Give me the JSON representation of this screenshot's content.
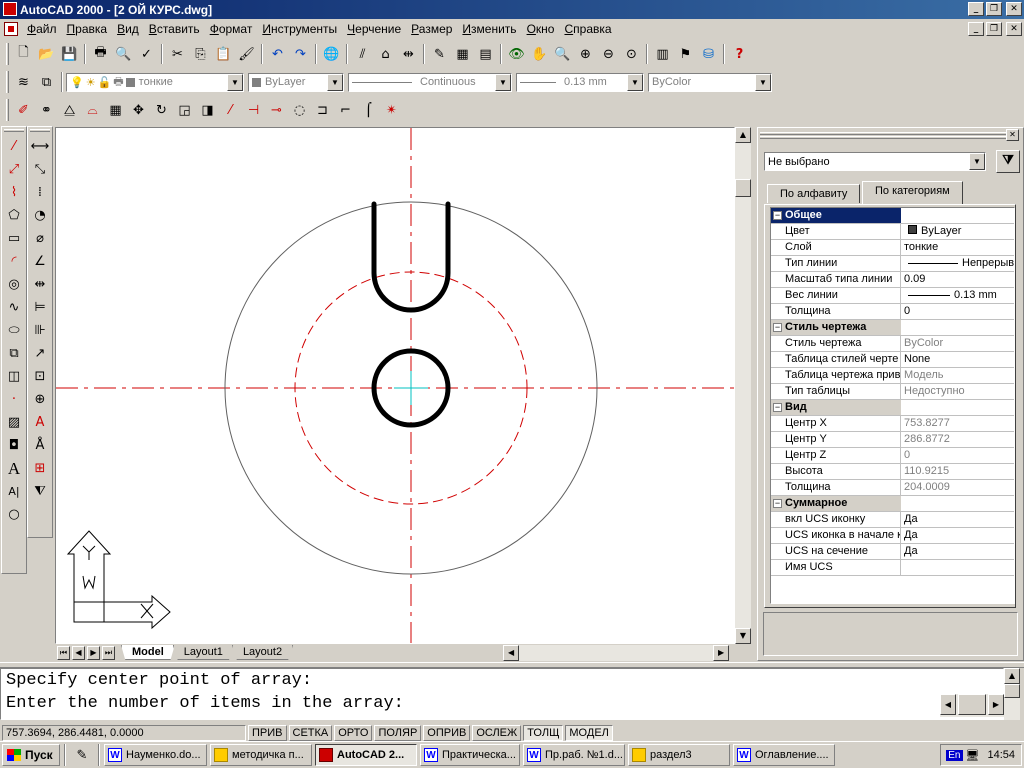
{
  "window": {
    "title": "AutoCAD 2000 - [2 ОЙ КУРС.dwg]",
    "min_glyph": "_",
    "max_glyph": "❐",
    "close_glyph": "✕"
  },
  "menu": {
    "items": [
      {
        "u": "Ф",
        "rest": "айл"
      },
      {
        "u": "П",
        "rest": "равка"
      },
      {
        "u": "В",
        "rest": "ид"
      },
      {
        "u": "В",
        "rest": "ставить"
      },
      {
        "u": "Ф",
        "rest": "ормат"
      },
      {
        "u": "И",
        "rest": "нструменты"
      },
      {
        "u": "Ч",
        "rest": "ерчение"
      },
      {
        "u": "Р",
        "rest": "азмер"
      },
      {
        "u": "И",
        "rest": "зменить"
      },
      {
        "u": "О",
        "rest": "кно"
      },
      {
        "u": "С",
        "rest": "правка"
      }
    ]
  },
  "layers_toolbar": {
    "layer": "тонкие",
    "color": "ByLayer",
    "linetype": "Continuous",
    "lineweight": "0.13 mm",
    "plotstyle": "ByColor"
  },
  "ucs_icon": {
    "x_label": "X",
    "y_label": "Y",
    "w_label": "W"
  },
  "layout_tabs": [
    "Model",
    "Layout1",
    "Layout2"
  ],
  "properties": {
    "selection": "Не выбрано",
    "tab_alpha": "По алфавиту",
    "tab_category": "По категориям",
    "groups": [
      {
        "name": "Общее",
        "rows": [
          {
            "k": "Цвет",
            "v": "ByLayer",
            "swatch": true
          },
          {
            "k": "Слой",
            "v": "тонкие"
          },
          {
            "k": "Тип линии",
            "v": "Непрерывн",
            "line": true
          },
          {
            "k": "Масштаб типа линии",
            "v": "0.09"
          },
          {
            "k": "Вес линии",
            "v": "0.13 mm",
            "line": true
          },
          {
            "k": "Толщина",
            "v": "0"
          }
        ]
      },
      {
        "name": "Стиль чертежа",
        "rows": [
          {
            "k": "Стиль чертежа",
            "v": "ByColor",
            "dim": true
          },
          {
            "k": "Таблица стилей черте",
            "v": "None"
          },
          {
            "k": "Таблица чертежа прив",
            "v": "Модель",
            "dim": true
          },
          {
            "k": "Тип таблицы",
            "v": "Недоступно",
            "dim": true
          }
        ]
      },
      {
        "name": "Вид",
        "rows": [
          {
            "k": "Центр X",
            "v": "753.8277",
            "dim": true
          },
          {
            "k": "Центр Y",
            "v": "286.8772",
            "dim": true
          },
          {
            "k": "Центр Z",
            "v": "0",
            "dim": true
          },
          {
            "k": "Высота",
            "v": "110.9215",
            "dim": true
          },
          {
            "k": "Толщина",
            "v": "204.0009",
            "dim": true
          }
        ]
      },
      {
        "name": "Суммарное",
        "rows": [
          {
            "k": "вкл UCS иконку",
            "v": "Да"
          },
          {
            "k": "UCS иконка в начале к",
            "v": "Да"
          },
          {
            "k": "UCS на сечение",
            "v": "Да"
          },
          {
            "k": "Имя UCS",
            "v": ""
          }
        ]
      }
    ]
  },
  "command": {
    "line1": "Specify center point of array:",
    "line2": "Enter the number of items in the array:"
  },
  "status": {
    "coords": "757.3694, 286.4481, 0.0000",
    "modes": [
      {
        "label": "ПРИВ",
        "on": false
      },
      {
        "label": "СЕТКА",
        "on": false
      },
      {
        "label": "ОРТО",
        "on": false
      },
      {
        "label": "ПОЛЯР",
        "on": false
      },
      {
        "label": "ОПРИВ",
        "on": false
      },
      {
        "label": "ОСЛЕЖ",
        "on": false
      },
      {
        "label": "ТОЛЩ",
        "on": true
      },
      {
        "label": "МОДЕЛ",
        "on": true
      }
    ]
  },
  "taskbar": {
    "start": "Пуск",
    "tasks": [
      {
        "label": "Науменко.do...",
        "icon": "w",
        "active": false
      },
      {
        "label": "методичка п...",
        "icon": "f",
        "active": false
      },
      {
        "label": "AutoCAD 2...",
        "icon": "a",
        "active": true
      },
      {
        "label": "Практическа...",
        "icon": "w",
        "active": false
      },
      {
        "label": "Пр.раб. №1.d...",
        "icon": "w",
        "active": false
      },
      {
        "label": "раздел3",
        "icon": "f",
        "active": false
      },
      {
        "label": "Оглавление....",
        "icon": "w",
        "active": false
      }
    ],
    "lang": "En",
    "time": "14:54"
  },
  "colors": {
    "center_line": "#d00000",
    "geometry": "#000000",
    "thin_circle": "#606060",
    "cursor": "#00c0c0"
  }
}
